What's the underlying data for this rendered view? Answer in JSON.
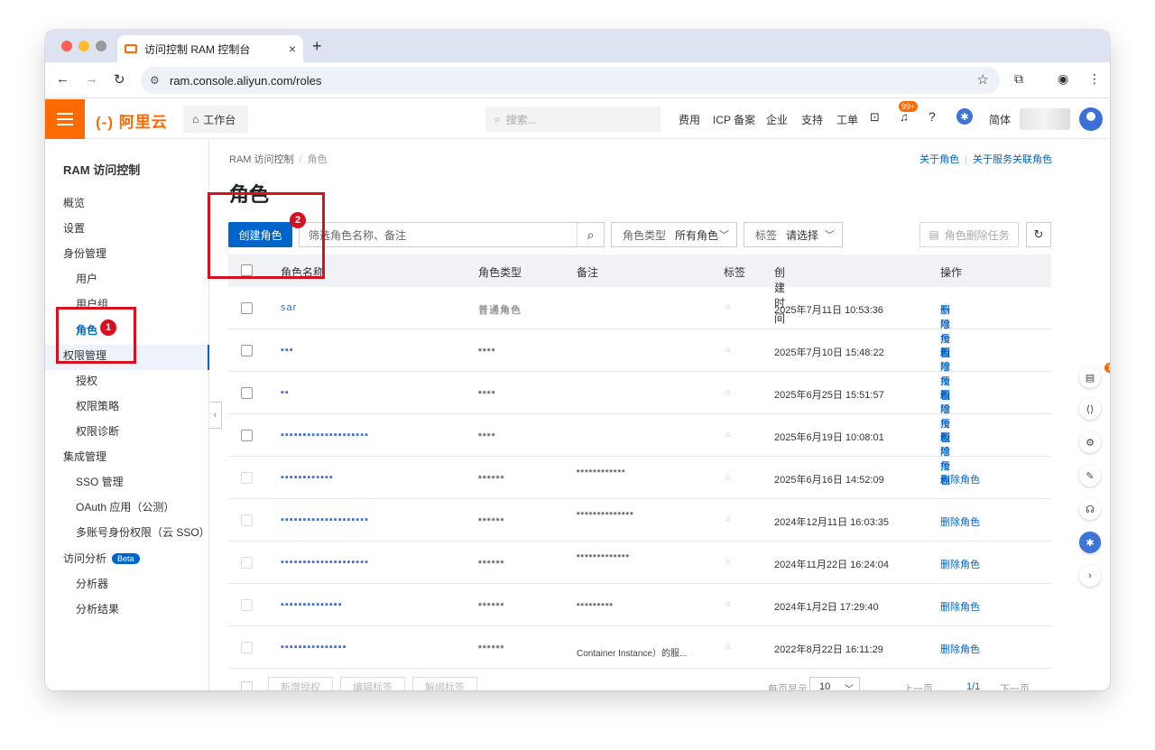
{
  "browser": {
    "tab_title": "访问控制 RAM 控制台",
    "url": "ram.console.aliyun.com/roles",
    "new_tab": "+",
    "close": "×"
  },
  "header": {
    "logo": "(-) 阿里云",
    "workbench": "工作台",
    "search_placeholder": "搜索...",
    "nav": [
      "费用",
      "ICP 备案",
      "企业",
      "支持",
      "工单"
    ],
    "notification_badge": "99+",
    "language": "简体"
  },
  "sidebar": {
    "title": "RAM 访问控制",
    "items": [
      {
        "label": "概览",
        "level": "top"
      },
      {
        "label": "设置",
        "level": "top"
      },
      {
        "label": "身份管理",
        "level": "top"
      },
      {
        "label": "用户",
        "level": "sub"
      },
      {
        "label": "用户组",
        "level": "sub"
      },
      {
        "label": "角色",
        "level": "sub",
        "active": true
      },
      {
        "label": "权限管理",
        "level": "top"
      },
      {
        "label": "授权",
        "level": "sub"
      },
      {
        "label": "权限策略",
        "level": "sub"
      },
      {
        "label": "权限诊断",
        "level": "sub"
      },
      {
        "label": "集成管理",
        "level": "top"
      },
      {
        "label": "SSO 管理",
        "level": "sub"
      },
      {
        "label": "OAuth 应用（公测）",
        "level": "sub"
      },
      {
        "label": "多账号身份权限（云 SSO）",
        "level": "sub"
      },
      {
        "label": "访问分析",
        "level": "top"
      },
      {
        "label": "分析器",
        "level": "sub"
      },
      {
        "label": "分析结果",
        "level": "sub"
      }
    ],
    "beta_label": "Beta"
  },
  "main": {
    "breadcrumb": [
      "RAM 访问控制",
      "角色"
    ],
    "breadcrumb_sep": "/",
    "top_links": [
      "关于角色",
      "关于服务关联角色"
    ],
    "page_title": "角色",
    "create_button": "创建角色",
    "filter_placeholder": "筛选角色名称、备注",
    "role_type_label": "角色类型",
    "role_type_value": "所有角色",
    "tag_label": "标签",
    "tag_value": "请选择",
    "delete_task_button": "角色删除任务"
  },
  "table": {
    "columns": [
      "角色名称",
      "角色类型",
      "备注",
      "标签",
      "创建时间",
      "操作"
    ],
    "sort_indicator": "↑l",
    "rows": [
      {
        "name": "sar",
        "type": "普通角色",
        "note": "",
        "created": "2025年7月11日 10:53:36",
        "actions": [
          "新增授权",
          "删除角色"
        ]
      },
      {
        "name": "▪▪▪",
        "type": "▪▪▪▪",
        "note": "",
        "created": "2025年7月10日 15:48:22",
        "actions": [
          "新增授权",
          "删除角色"
        ]
      },
      {
        "name": "▪▪",
        "type": "▪▪▪▪",
        "note": "",
        "created": "2025年6月25日 15:51:57",
        "actions": [
          "新增授权",
          "删除角色"
        ]
      },
      {
        "name": "▪▪▪▪▪▪▪▪▪▪▪▪▪▪▪▪▪▪▪▪",
        "type": "▪▪▪▪",
        "note": "",
        "created": "2025年6月19日 10:08:01",
        "actions": [
          "新增授权",
          "删除角色"
        ]
      },
      {
        "name": "▪▪▪▪▪▪▪▪▪▪▪▪",
        "type": "▪▪▪▪▪▪",
        "note": "▪▪▪▪▪▪▪▪▪▪▪▪",
        "created": "2025年6月16日 14:52:09",
        "actions": [
          "删除角色"
        ]
      },
      {
        "name": "▪▪▪▪▪▪▪▪▪▪▪▪▪▪▪▪▪▪▪▪",
        "type": "▪▪▪▪▪▪",
        "note": "▪▪▪▪▪▪▪▪▪▪▪▪▪▪",
        "created": "2024年12月11日 16:03:35",
        "actions": [
          "删除角色"
        ]
      },
      {
        "name": "▪▪▪▪▪▪▪▪▪▪▪▪▪▪▪▪▪▪▪▪",
        "type": "▪▪▪▪▪▪",
        "note": "▪▪▪▪▪▪▪▪▪▪▪▪▪",
        "created": "2024年11月22日 16:24:04",
        "actions": [
          "删除角色"
        ]
      },
      {
        "name": "▪▪▪▪▪▪▪▪▪▪▪▪▪▪",
        "type": "▪▪▪▪▪▪",
        "note": "▪▪▪▪▪▪▪▪▪",
        "created": "2024年1月2日 17:29:40",
        "actions": [
          "删除角色"
        ]
      },
      {
        "name": "▪▪▪▪▪▪▪▪▪▪▪▪▪▪▪",
        "type": "▪▪▪▪▪▪",
        "note": "Container Instance）的服...",
        "created": "2022年8月22日 16:11:29",
        "actions": [
          "删除角色"
        ]
      }
    ]
  },
  "footer": {
    "batch_buttons": [
      "新增授权",
      "编辑标签",
      "解绑标签"
    ],
    "page_size_label": "每页显示",
    "page_size": "10",
    "prev": "上一页",
    "page": "1/1",
    "next": "下一页"
  },
  "annotations": {
    "step1": "1",
    "step2": "2",
    "color": "#d6101e"
  },
  "colors": {
    "brand": "#ff6a00",
    "primary": "#0064c8"
  },
  "dock": {
    "notification_count": "1"
  }
}
